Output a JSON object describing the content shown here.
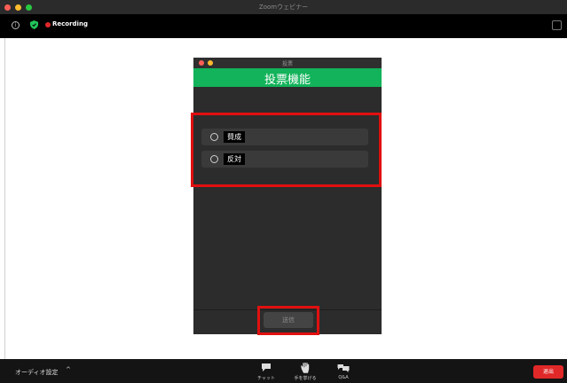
{
  "window": {
    "title": "Zoomウェビナー"
  },
  "status": {
    "recording": "Recording"
  },
  "poll": {
    "window_title": "投票",
    "heading": "投票機能",
    "options": [
      "賛成",
      "反対"
    ],
    "submit_label": "送信"
  },
  "toolbar": {
    "audio_settings": "オーディオ設定",
    "chat": "チャット",
    "raise_hand": "手を挙げる",
    "qa": "Q&A",
    "exit": "退出"
  },
  "colors": {
    "accent_green": "#12b35a",
    "highlight_red": "#e01010",
    "exit_red": "#e02828"
  },
  "icons": [
    "info-icon",
    "shield-icon",
    "recording-dot-icon",
    "fullscreen-icon",
    "radio-icon",
    "chevron-up-icon",
    "chat-icon",
    "raise-hand-icon",
    "qa-icon"
  ]
}
